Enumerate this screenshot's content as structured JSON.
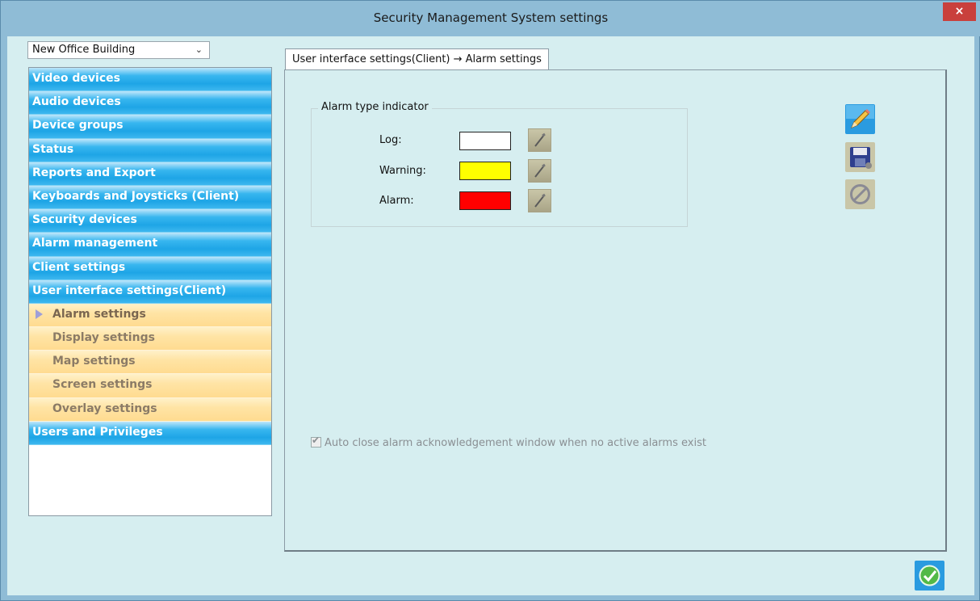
{
  "window": {
    "title": "Security Management System settings",
    "close_label": "×"
  },
  "site_select": {
    "value": "New Office Building"
  },
  "nav": {
    "items": [
      {
        "label": "Video devices"
      },
      {
        "label": "Audio devices"
      },
      {
        "label": "Device groups"
      },
      {
        "label": "Status"
      },
      {
        "label": "Reports and Export"
      },
      {
        "label": "Keyboards and Joysticks (Client)"
      },
      {
        "label": "Security devices"
      },
      {
        "label": "Alarm management"
      },
      {
        "label": "Client settings"
      },
      {
        "label": "User interface settings(Client)"
      }
    ],
    "sub_items": [
      {
        "label": "Alarm settings",
        "active": true
      },
      {
        "label": "Display settings"
      },
      {
        "label": "Map settings"
      },
      {
        "label": "Screen settings"
      },
      {
        "label": "Overlay settings"
      }
    ],
    "last_item": {
      "label": "Users and Privileges"
    }
  },
  "tab": {
    "label": "User interface settings(Client) → Alarm settings"
  },
  "alarm_group": {
    "legend": "Alarm type indicator",
    "rows": [
      {
        "label": "Log:",
        "color": "#ffffff"
      },
      {
        "label": "Warning:",
        "color": "#ffff00"
      },
      {
        "label": "Alarm:",
        "color": "#ff0000"
      }
    ]
  },
  "toolbar": {
    "icons": [
      "pencil-icon",
      "save-icon",
      "cancel-icon"
    ]
  },
  "auto_close": {
    "label": "Auto close alarm acknowledgement window when no active alarms exist",
    "checked": true
  },
  "colors": {
    "accent_blue": "#1ea5e6",
    "sub_item_bg": "#ffdb90",
    "panel_bg": "#d6eef0"
  }
}
